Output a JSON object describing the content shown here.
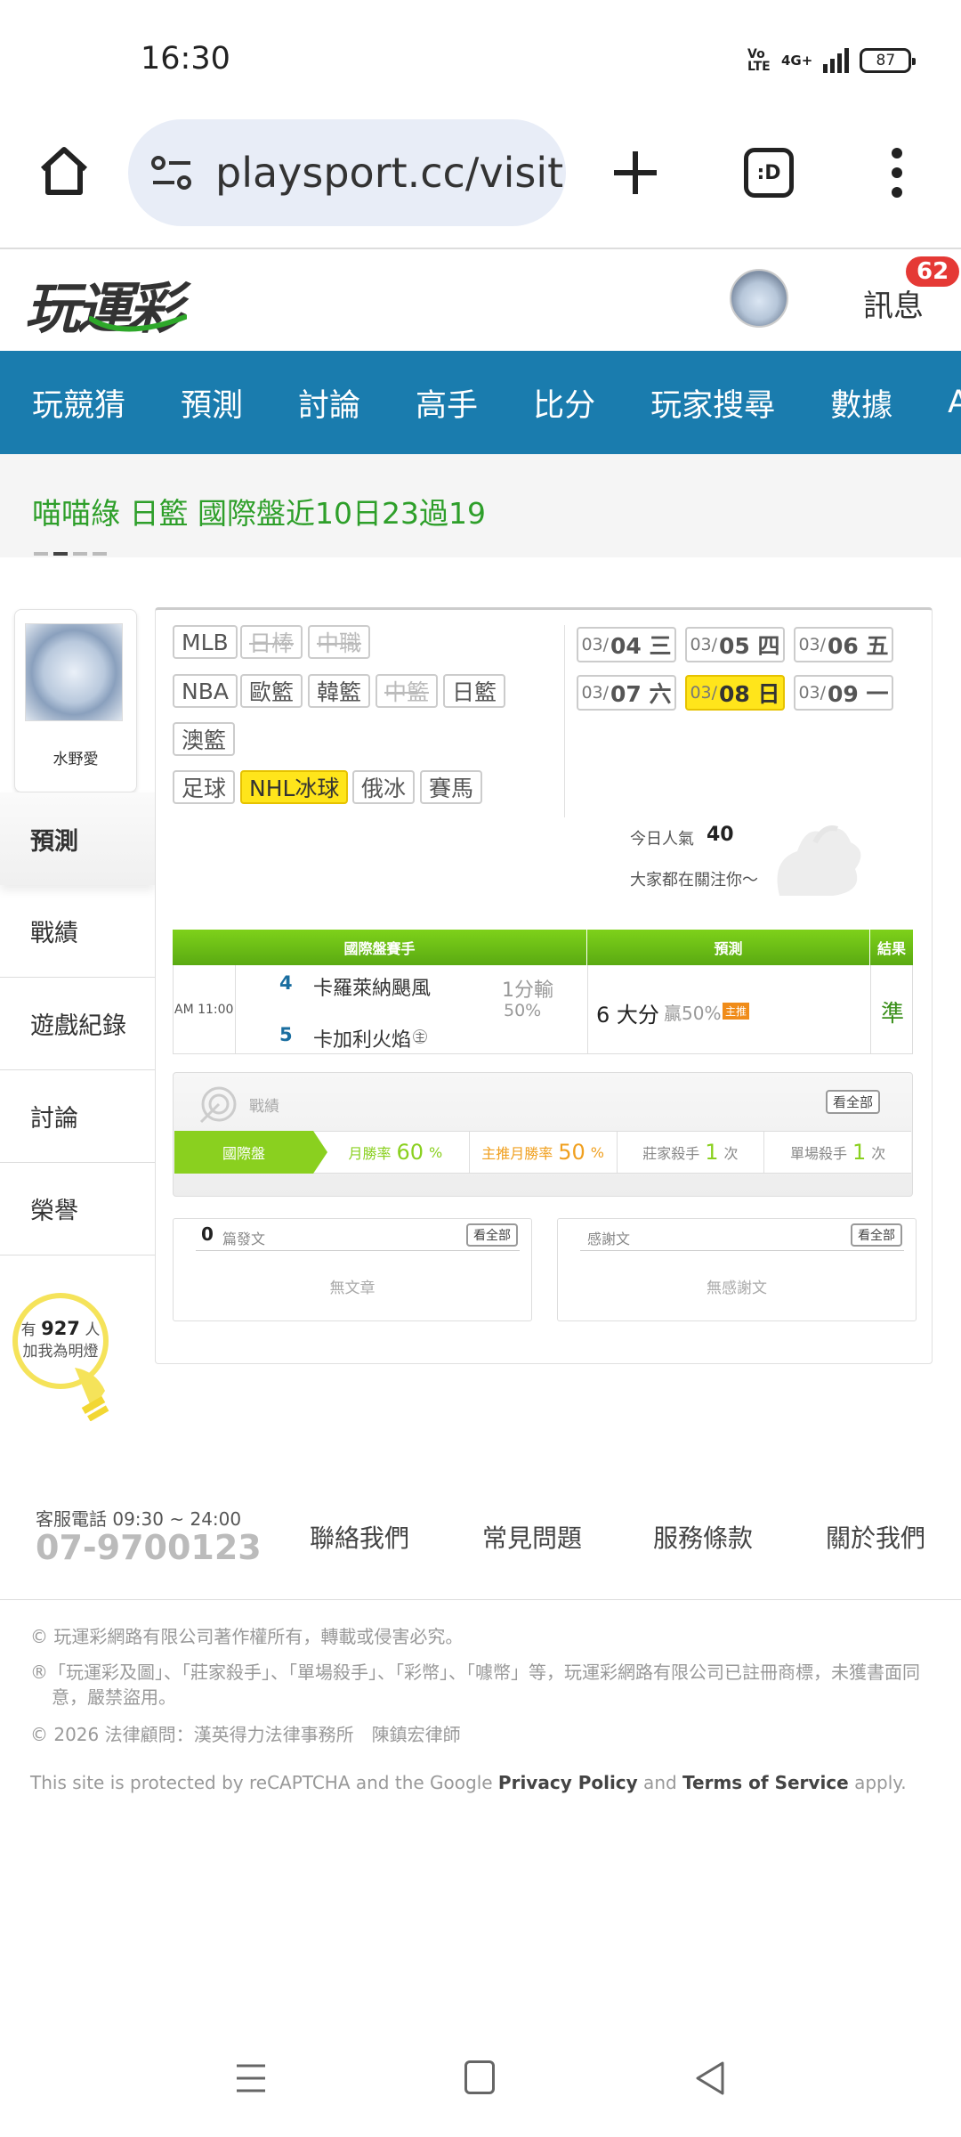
{
  "status_bar": {
    "time": "16:30",
    "volte": "Vo LTE",
    "network": "4G+",
    "battery": "87"
  },
  "browser": {
    "url": "playsport.cc/visit",
    "tabs_label": ":D"
  },
  "header": {
    "logo": "玩運彩",
    "messages_label": "訊息",
    "messages_badge": "62"
  },
  "nav": {
    "items": [
      "玩競猜",
      "預測",
      "討論",
      "高手",
      "比分",
      "玩家搜尋",
      "數據",
      "APP"
    ]
  },
  "ticker": {
    "text": "喵喵綠 日籃 國際盤近10日23過19"
  },
  "profile": {
    "name": "水野愛"
  },
  "side_tabs": [
    "預測",
    "戰績",
    "遊戲紀錄",
    "討論",
    "榮譽"
  ],
  "fans": {
    "prefix": "有",
    "count": "927",
    "suffix": "人",
    "line2": "加我為明燈"
  },
  "sports": {
    "row1": [
      "MLB",
      "日棒",
      "中職"
    ],
    "row2": [
      "NBA",
      "歐籃",
      "韓籃",
      "中籃",
      "日籃"
    ],
    "row3": [
      "澳籃"
    ],
    "row4": [
      "足球",
      "NHL冰球",
      "俄冰",
      "賽馬"
    ]
  },
  "dates": [
    {
      "month": "03/",
      "day": "04 三"
    },
    {
      "month": "03/",
      "day": "05 四"
    },
    {
      "month": "03/",
      "day": "06 五"
    },
    {
      "month": "03/",
      "day": "07 六"
    },
    {
      "month": "03/",
      "day": "08 日"
    },
    {
      "month": "03/",
      "day": "09 一"
    }
  ],
  "popularity": {
    "label": "今日人氣",
    "value": "40",
    "watch_label": "大家都在關注你～"
  },
  "prediction_table": {
    "headers": [
      "國際盤賽手",
      "預測",
      "結果"
    ],
    "time": "AM 11:00",
    "team1_num": "4",
    "team1_name": "卡羅萊納颶風",
    "team2_num": "5",
    "team2_name": "卡加利火焰",
    "team2_host": "主",
    "spread": "1分輸",
    "spread_pct": "50%",
    "prediction": "6 大分",
    "prediction_win": "贏50%",
    "prediction_chip": "主推",
    "result": "準"
  },
  "record": {
    "label": "戰績",
    "view_all": "看全部",
    "tab": "國際盤",
    "month_rate_label": "月勝率",
    "month_rate": "60",
    "pct": "%",
    "main_rate_label": "主推月勝率",
    "main_rate": "50",
    "home_killer_label": "莊家殺手",
    "home_killer": "1",
    "times": "次",
    "single_killer_label": "單場殺手",
    "single_killer": "1"
  },
  "articles": {
    "count": "0",
    "label": "篇發文",
    "view_all": "看全部",
    "empty": "無文章"
  },
  "thanks": {
    "label": "感謝文",
    "view_all": "看全部",
    "empty": "無感謝文"
  },
  "footer": {
    "cs_label": "客服電話 09:30 ~ 24:00",
    "cs_phone": "07-9700123",
    "links": [
      "聯絡我們",
      "常見問題",
      "服務條款",
      "關於我們"
    ],
    "copyright": "© 玩運彩網路有限公司著作權所有，轉載或侵害必究。",
    "trademark": "®「玩運彩及圖」、「莊家殺手」、「單場殺手」、「彩幣」、「噱幣」等，玩運彩網路有限公司已註冊商標，未獲書面同意，嚴禁盜用。",
    "legal": "© 2026 法律顧問：漢英得力法律事務所　陳鎮宏律師",
    "recaptcha_pre": "This site is protected by reCAPTCHA and the Google ",
    "privacy": "Privacy Policy",
    "and": " and ",
    "terms": "Terms of Service",
    "apply": " apply."
  }
}
